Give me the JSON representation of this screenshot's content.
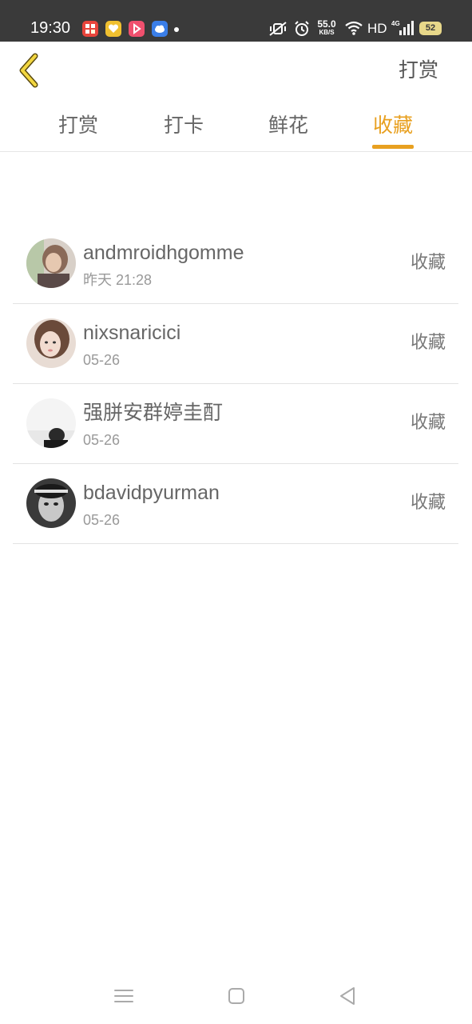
{
  "status_bar": {
    "time": "19:30",
    "apps": [
      {
        "icon": "app-red-icon",
        "color": "#e8453c"
      },
      {
        "icon": "app-yellow-heart-icon",
        "color": "#f0c030"
      },
      {
        "icon": "app-pink-play-icon",
        "color": "#f0506e"
      },
      {
        "icon": "app-blue-cloud-icon",
        "color": "#3a7ee8"
      }
    ],
    "net_speed_value": "55.0",
    "net_speed_unit": "KB/S",
    "network_label": "HD",
    "signal_label": "4G",
    "battery": "52"
  },
  "header": {
    "back_icon": "chevron-left-icon",
    "action_label": "打赏"
  },
  "tabs": [
    {
      "label": "打赏",
      "active": false
    },
    {
      "label": "打卡",
      "active": false
    },
    {
      "label": "鲜花",
      "active": false
    },
    {
      "label": "收藏",
      "active": true
    }
  ],
  "colors": {
    "accent": "#e8a020",
    "status_bar_bg": "#3a3a3a"
  },
  "list": [
    {
      "name": "andmroidhgomme",
      "time": "昨天 21:28",
      "action": "收藏"
    },
    {
      "name": "nixsnaricici",
      "time": "05-26",
      "action": "收藏"
    },
    {
      "name": "强胼安群婷圭酊",
      "time": "05-26",
      "action": "收藏"
    },
    {
      "name": "bdavidpyurman",
      "time": "05-26",
      "action": "收藏"
    }
  ],
  "navbar": {
    "menu_icon": "menu-icon",
    "home_icon": "home-square-icon",
    "back_icon": "back-triangle-icon"
  }
}
